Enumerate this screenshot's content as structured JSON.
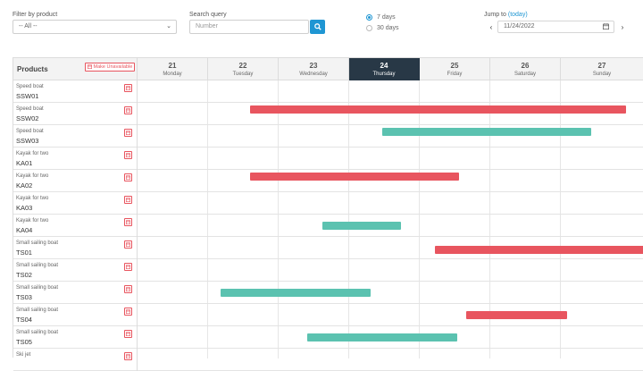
{
  "filters": {
    "product_label": "Filter by product",
    "product_value": "-- All --",
    "search_label": "Search query",
    "search_placeholder": "Number",
    "range_options": [
      "7 days",
      "30 days"
    ],
    "range_selected": "7 days",
    "jump_label": "Jump to",
    "today_link": "(today)",
    "date_value": "11/24/2022"
  },
  "grid": {
    "products_header": "Products",
    "make_unavailable": "Make Unavailable",
    "days": [
      {
        "num": "21",
        "weekday": "Monday"
      },
      {
        "num": "22",
        "weekday": "Tuesday"
      },
      {
        "num": "23",
        "weekday": "Wednesday"
      },
      {
        "num": "24",
        "weekday": "Thursday",
        "today": true
      },
      {
        "num": "25",
        "weekday": "Friday"
      },
      {
        "num": "26",
        "weekday": "Saturday"
      },
      {
        "num": "27",
        "weekday": "Sunday"
      }
    ],
    "rows": [
      {
        "type": "Speed boat",
        "code": "SSW01"
      },
      {
        "type": "Speed boat",
        "code": "SSW02"
      },
      {
        "type": "Speed boat",
        "code": "SSW03"
      },
      {
        "type": "Kayak for two",
        "code": "KA01"
      },
      {
        "type": "Kayak for two",
        "code": "KA02"
      },
      {
        "type": "Kayak for two",
        "code": "KA03"
      },
      {
        "type": "Kayak for two",
        "code": "KA04"
      },
      {
        "type": "Small sailing boat",
        "code": "TS01"
      },
      {
        "type": "Small sailing boat",
        "code": "TS02"
      },
      {
        "type": "Small sailing boat",
        "code": "TS03"
      },
      {
        "type": "Small sailing boat",
        "code": "TS04"
      },
      {
        "type": "Small sailing boat",
        "code": "TS05"
      },
      {
        "type": "Ski jet",
        "code": ""
      }
    ]
  },
  "colors": {
    "accent": "#1f96d3",
    "reservation_red": "#e8555f",
    "reservation_teal": "#5bc2b0",
    "today_header": "#283846"
  }
}
